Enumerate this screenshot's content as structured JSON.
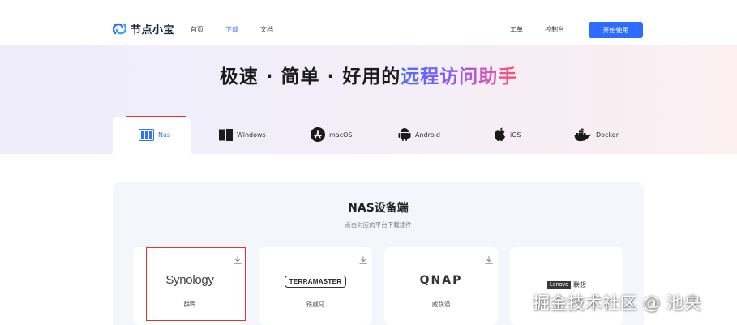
{
  "nav": {
    "logo_text": "节点小宝",
    "links": [
      "首页",
      "下载",
      "文档"
    ],
    "active_link": "下载",
    "right_links": [
      "工单",
      "控制台"
    ],
    "start_button": "开始使用"
  },
  "hero": {
    "title_plain": "极速 · 简单 · 好用的",
    "title_gradient": "远程访问助手"
  },
  "tabs": [
    {
      "label": "Nas",
      "icon": "nas-icon",
      "active": true
    },
    {
      "label": "Windows",
      "icon": "windows-icon"
    },
    {
      "label": "macOS",
      "icon": "appstore-icon"
    },
    {
      "label": "Android",
      "icon": "android-icon"
    },
    {
      "label": "iOS",
      "icon": "apple-icon"
    },
    {
      "label": "Docker",
      "icon": "docker-icon"
    }
  ],
  "panel": {
    "title": "NAS设备端",
    "subtitle": "点击对应的平台下载插件",
    "cards": [
      {
        "brand": "Synology",
        "name": "群晖"
      },
      {
        "brand": "TERRAMASTER",
        "name": "铁威马"
      },
      {
        "brand": "QNAP",
        "name": "威联通"
      },
      {
        "brand_tag": "Lenovo",
        "brand_cn": "联想",
        "name": ""
      }
    ]
  },
  "watermark": "掘金技术社区 @ 池央",
  "colors": {
    "accent": "#2e6bff",
    "highlight_box": "#e0362c",
    "panel_bg": "#f4f6fb"
  }
}
